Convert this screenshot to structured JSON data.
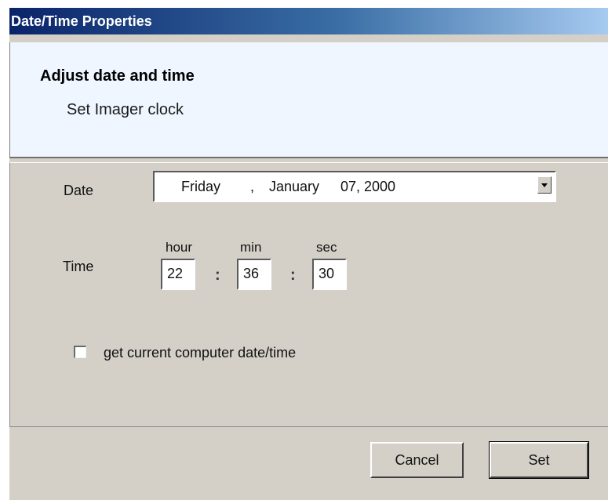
{
  "window": {
    "title": "Date/Time Properties"
  },
  "header": {
    "title": "Adjust date and time",
    "subtitle": "Set Imager clock"
  },
  "date": {
    "label": "Date",
    "weekday": "Friday",
    "separator": ",",
    "month": "January",
    "day_year": "07, 2000"
  },
  "time": {
    "label": "Time",
    "hour_label": "hour",
    "min_label": "min",
    "sec_label": "sec",
    "hour": "22",
    "min": "36",
    "sec": "30",
    "separator": ":"
  },
  "checkbox": {
    "label": "get current computer date/time",
    "checked": false
  },
  "buttons": {
    "cancel": "Cancel",
    "set": "Set"
  },
  "colors": {
    "dialog_bg": "#d4d0c8",
    "header_bg": "#eff6ff",
    "title_gradient_start": "#0a246a"
  }
}
